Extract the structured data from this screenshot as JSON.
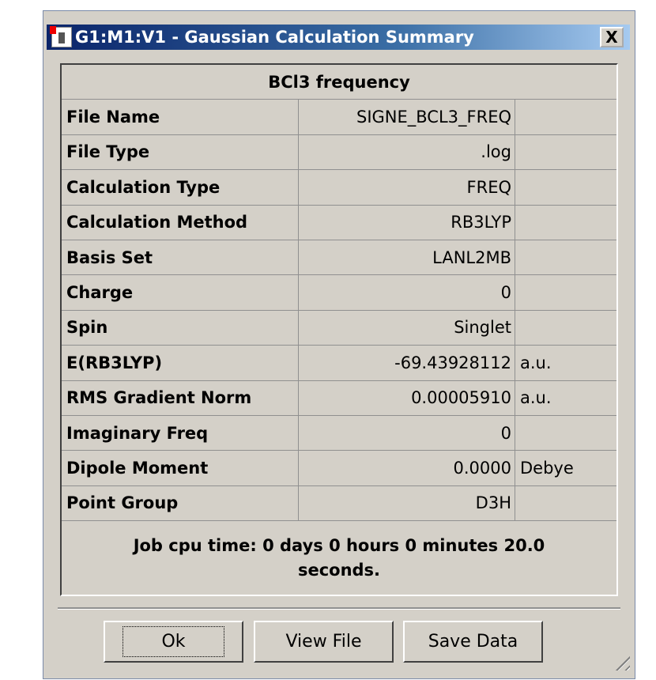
{
  "window": {
    "title": "G1:M1:V1 - Gaussian Calculation Summary",
    "close_label": "X"
  },
  "summary": {
    "heading": "BCl3 frequency",
    "rows": [
      {
        "label": "File Name",
        "value": "SIGNE_BCL3_FREQ",
        "unit": ""
      },
      {
        "label": "File Type",
        "value": ".log",
        "unit": ""
      },
      {
        "label": "Calculation Type",
        "value": "FREQ",
        "unit": ""
      },
      {
        "label": "Calculation Method",
        "value": "RB3LYP",
        "unit": ""
      },
      {
        "label": "Basis Set",
        "value": "LANL2MB",
        "unit": ""
      },
      {
        "label": "Charge",
        "value": "0",
        "unit": ""
      },
      {
        "label": "Spin",
        "value": "Singlet",
        "unit": ""
      },
      {
        "label": "E(RB3LYP)",
        "value": "-69.43928112",
        "unit": "a.u."
      },
      {
        "label": "RMS Gradient Norm",
        "value": "0.00005910",
        "unit": "a.u."
      },
      {
        "label": "Imaginary Freq",
        "value": "0",
        "unit": ""
      },
      {
        "label": "Dipole Moment",
        "value": "0.0000",
        "unit": "Debye"
      },
      {
        "label": "Point Group",
        "value": "D3H",
        "unit": ""
      }
    ],
    "footer": "Job cpu time:  0 days  0 hours  0 minutes 20.0 seconds."
  },
  "buttons": {
    "ok": "Ok",
    "view_file": "View File",
    "save_data": "Save Data"
  }
}
